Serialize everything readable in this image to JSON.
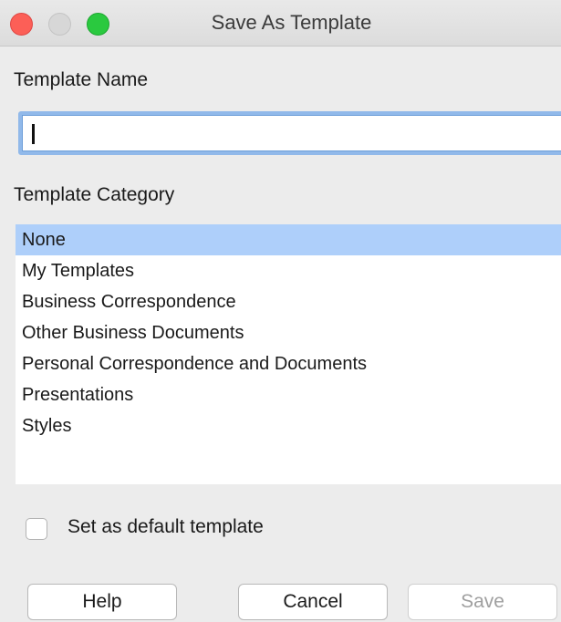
{
  "window": {
    "title": "Save As Template"
  },
  "form": {
    "name_label": "Template Name",
    "name_value": "",
    "category_label": "Template Category",
    "categories": [
      "None",
      "My Templates",
      "Business Correspondence",
      "Other Business Documents",
      "Personal Correspondence and Documents",
      "Presentations",
      "Styles"
    ],
    "selected_category": "None",
    "default_checkbox_label": "Set as default template",
    "default_checked": false
  },
  "buttons": {
    "help": "Help",
    "cancel": "Cancel",
    "save": "Save",
    "save_enabled": false
  },
  "colors": {
    "selection": "#aecffa",
    "focus_ring": "#91b9ea",
    "close": "#fc5f57",
    "maximize": "#2ac93f",
    "disabled_text": "#9f9f9f"
  }
}
